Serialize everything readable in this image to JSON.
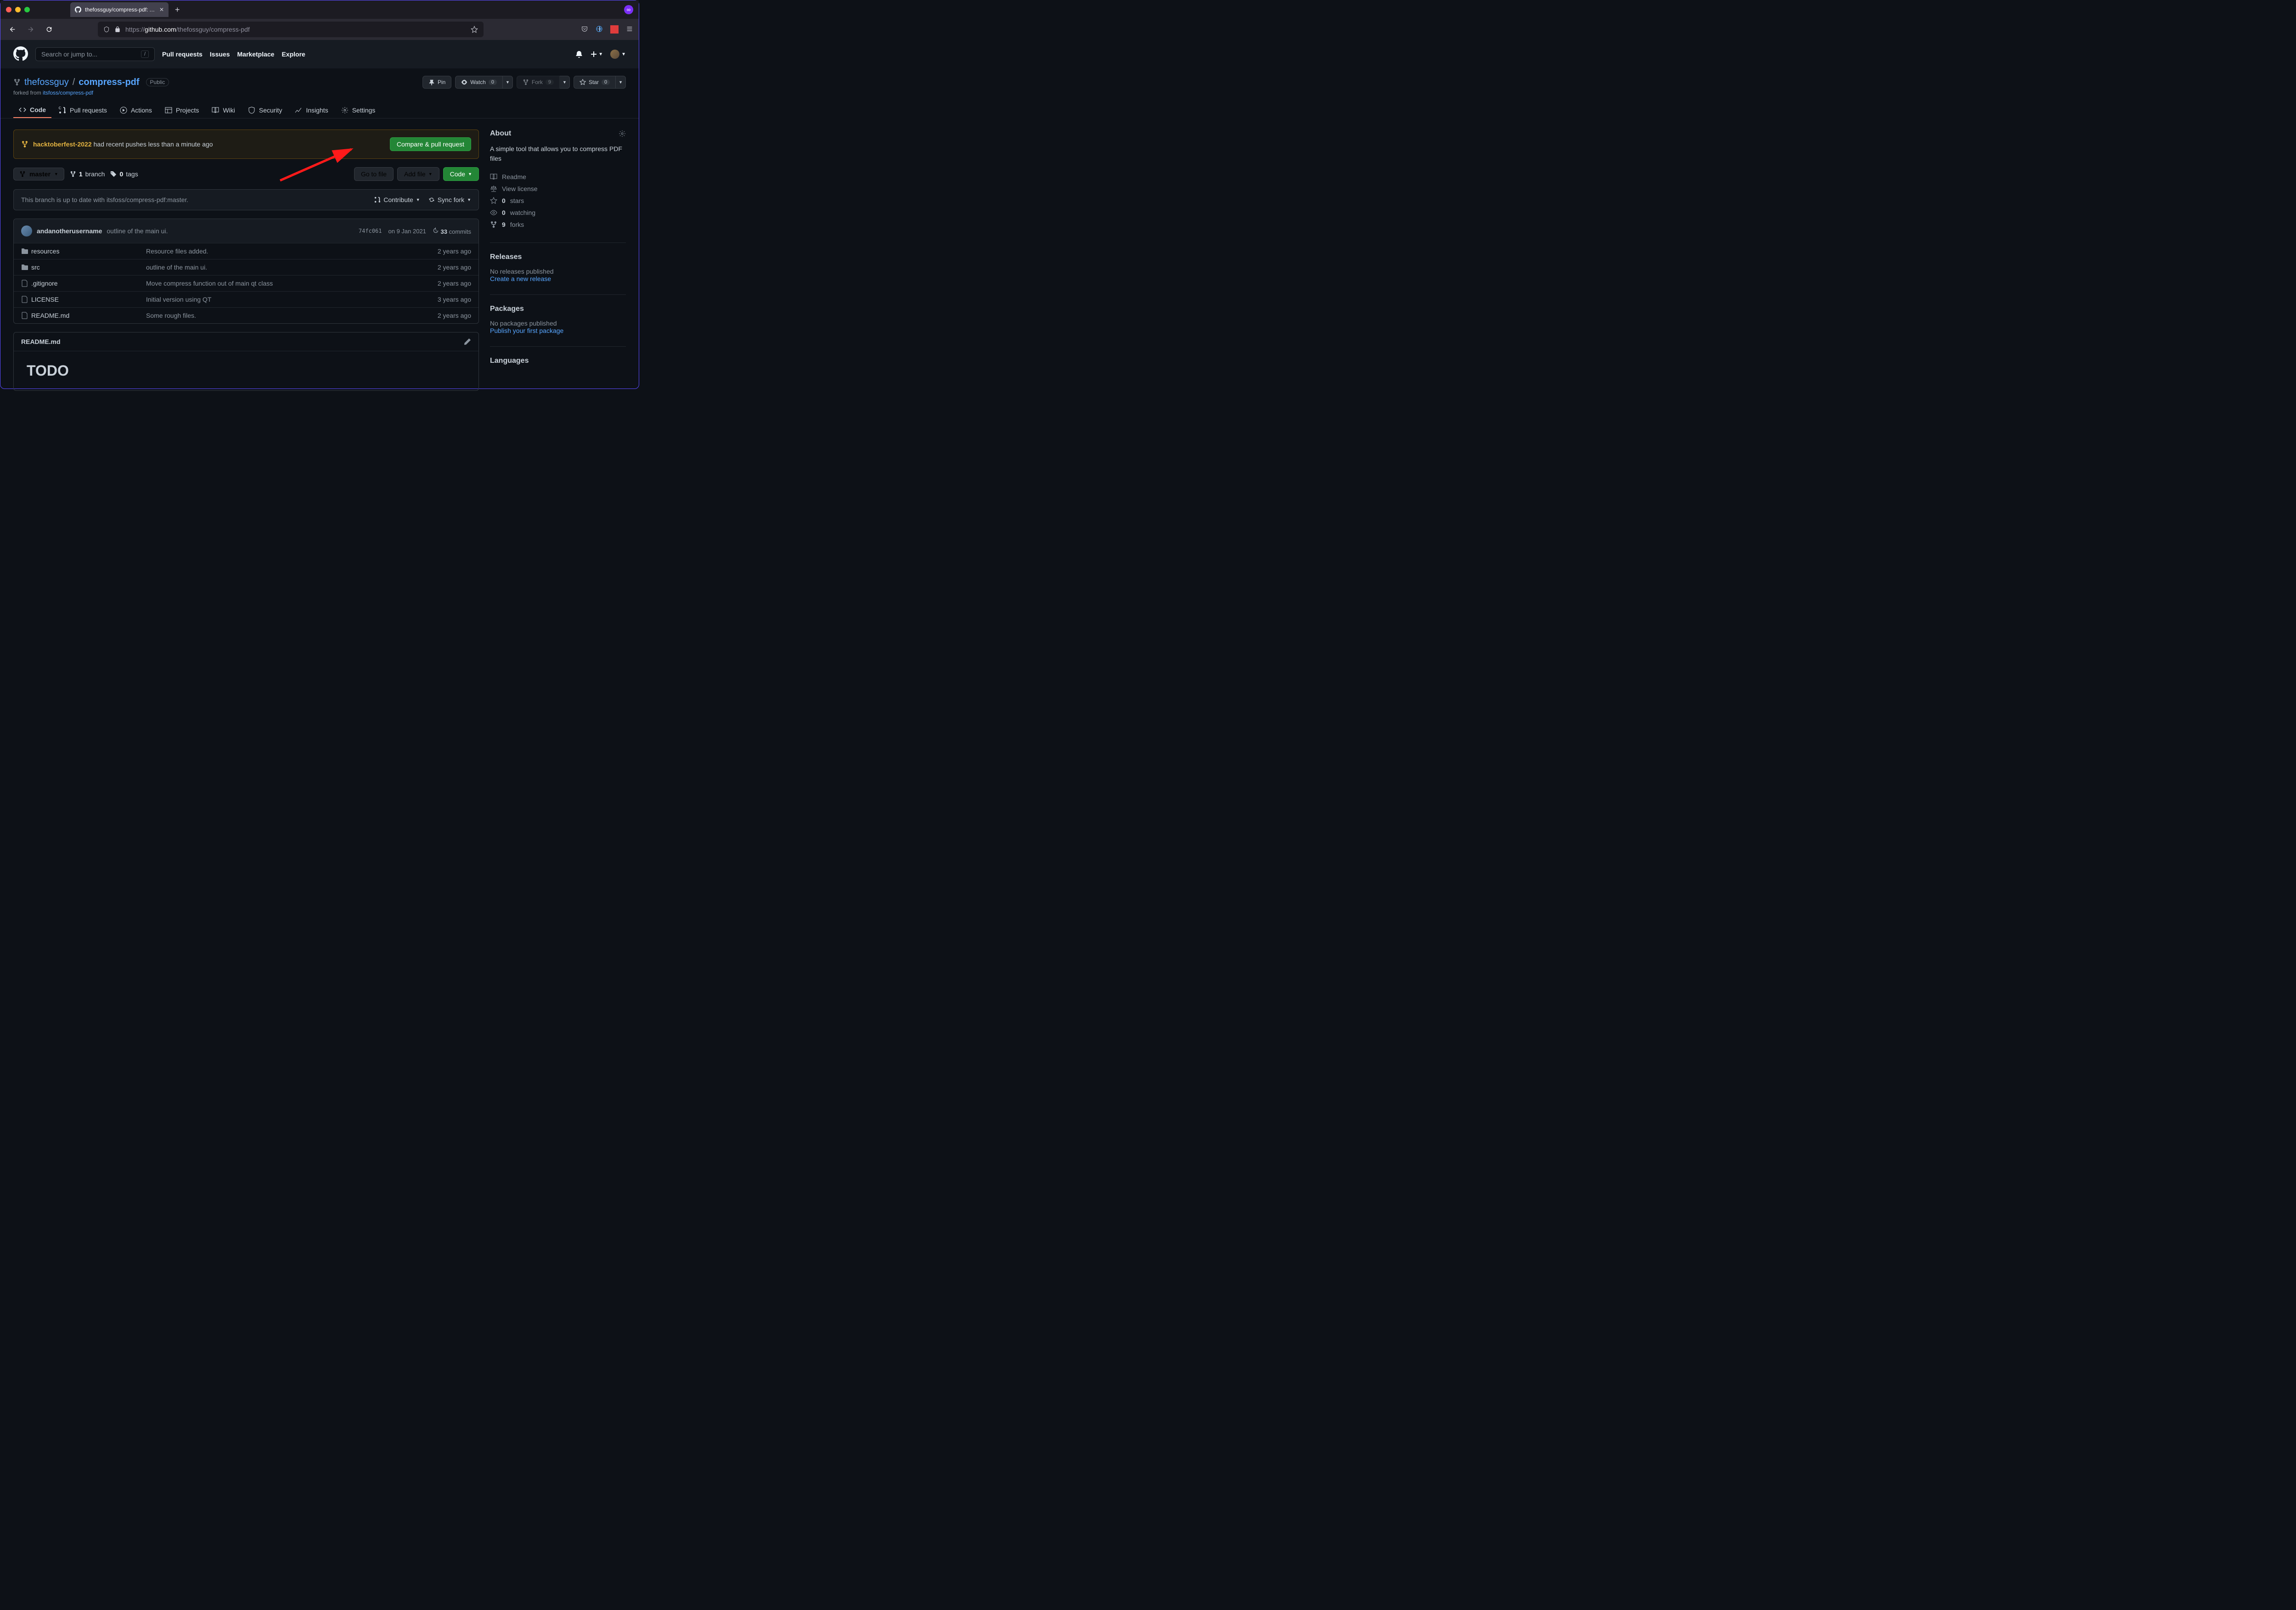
{
  "browser": {
    "tab_title": "thefossguy/compress-pdf: A sim",
    "url_proto": "https://",
    "url_domain": "github.com",
    "url_path": "/thefossguy/compress-pdf"
  },
  "gh_header": {
    "search_placeholder": "Search or jump to...",
    "slash": "/",
    "nav": {
      "pulls": "Pull requests",
      "issues": "Issues",
      "marketplace": "Marketplace",
      "explore": "Explore"
    }
  },
  "repo": {
    "owner": "thefossguy",
    "name": "compress-pdf",
    "visibility": "Public",
    "forked_prefix": "forked from ",
    "forked_from": "itsfoss/compress-pdf",
    "actions": {
      "pin": "Pin",
      "watch": "Watch",
      "watch_count": "0",
      "fork": "Fork",
      "fork_count": "9",
      "star": "Star",
      "star_count": "0"
    }
  },
  "repo_nav": {
    "code": "Code",
    "pulls": "Pull requests",
    "actions": "Actions",
    "projects": "Projects",
    "wiki": "Wiki",
    "security": "Security",
    "insights": "Insights",
    "settings": "Settings"
  },
  "alert": {
    "branch": "hacktoberfest-2022",
    "msg": " had recent pushes less than a minute ago",
    "button": "Compare & pull request"
  },
  "branch_row": {
    "branch": "master",
    "branches_count": "1",
    "branches_label": " branch",
    "tags_count": "0",
    "tags_label": " tags",
    "gotofile": "Go to file",
    "addfile": "Add file",
    "code": "Code"
  },
  "branch_status": {
    "text": "This branch is up to date with itsfoss/compress-pdf:master.",
    "contribute": "Contribute",
    "syncfork": "Sync fork"
  },
  "commit": {
    "author": "andanotherusername",
    "msg": "outline of the main ui.",
    "sha": "74fc061",
    "date": "on 9 Jan 2021",
    "count": "33",
    "count_label": " commits"
  },
  "files": [
    {
      "type": "dir",
      "name": "resources",
      "msg": "Resource files added.",
      "age": "2 years ago"
    },
    {
      "type": "dir",
      "name": "src",
      "msg": "outline of the main ui.",
      "age": "2 years ago"
    },
    {
      "type": "file",
      "name": ".gitignore",
      "msg": "Move compress function out of main qt class",
      "age": "2 years ago"
    },
    {
      "type": "file",
      "name": "LICENSE",
      "msg": "Initial version using QT",
      "age": "3 years ago"
    },
    {
      "type": "file",
      "name": "README.md",
      "msg": "Some rough files.",
      "age": "2 years ago"
    }
  ],
  "readme": {
    "filename": "README.md",
    "heading": "TODO"
  },
  "sidebar": {
    "about_title": "About",
    "about_desc": "A simple tool that allows you to compress PDF files",
    "readme": "Readme",
    "license": "View license",
    "stars_n": "0",
    "stars_l": " stars",
    "watching_n": "0",
    "watching_l": " watching",
    "forks_n": "9",
    "forks_l": " forks",
    "releases_title": "Releases",
    "releases_none": "No releases published",
    "releases_create": "Create a new release",
    "packages_title": "Packages",
    "packages_none": "No packages published",
    "packages_publish": "Publish your first package",
    "languages_title": "Languages"
  }
}
